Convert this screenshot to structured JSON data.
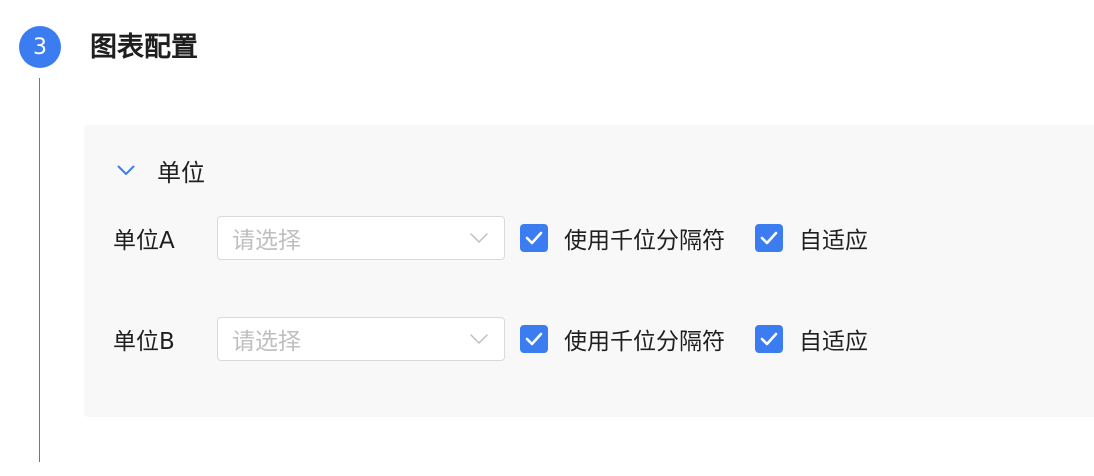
{
  "step": {
    "number": "3",
    "title": "图表配置",
    "color": "#3b7cf1"
  },
  "section": {
    "title": "单位",
    "expanded": true,
    "icon": "chevron-down-icon"
  },
  "rows": [
    {
      "label": "单位A",
      "select_placeholder": "请选择",
      "thousands_label": "使用千位分隔符",
      "thousands_checked": true,
      "adaptive_label": "自适应",
      "adaptive_checked": true
    },
    {
      "label": "单位B",
      "select_placeholder": "请选择",
      "thousands_label": "使用千位分隔符",
      "thousands_checked": true,
      "adaptive_label": "自适应",
      "adaptive_checked": true
    }
  ]
}
